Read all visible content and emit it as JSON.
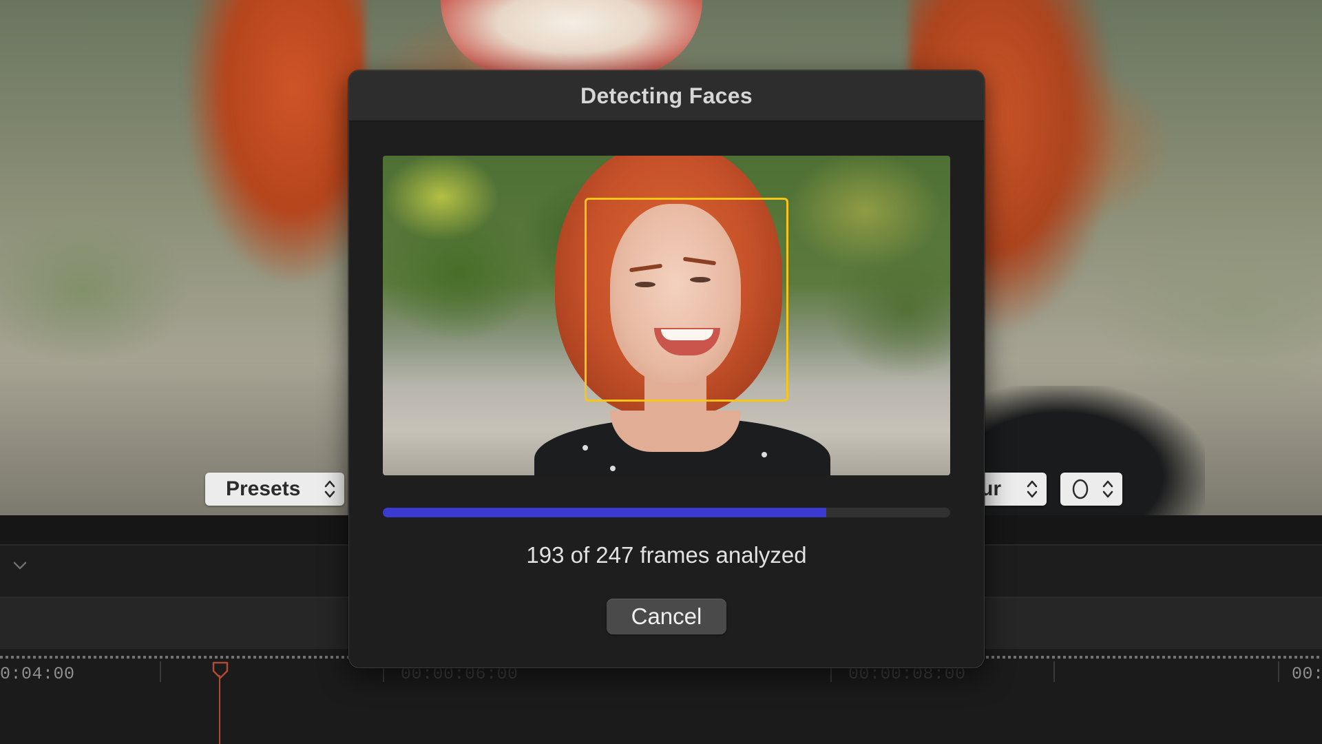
{
  "viewer": {
    "presets_label": "Presets",
    "right_control_label": "ur"
  },
  "timeline": {
    "timecodes": [
      "0:04:00",
      "00:00:06:00",
      "00:00:08:00",
      "00:"
    ]
  },
  "dialog": {
    "title": "Detecting Faces",
    "frames_analyzed": 193,
    "frames_total": 247,
    "progress_fraction": 0.7814,
    "status_text": "193 of 247 frames analyzed",
    "cancel_label": "Cancel"
  },
  "colors": {
    "progress_fill": "#3a3ad0",
    "face_box": "#f5c518",
    "playhead": "#b24a33"
  },
  "icons": {
    "popup_stepper": "chevron-up-down-icon",
    "shape": "oval-shape-icon",
    "collapse": "chevron-down-icon",
    "playhead": "playhead-icon"
  }
}
